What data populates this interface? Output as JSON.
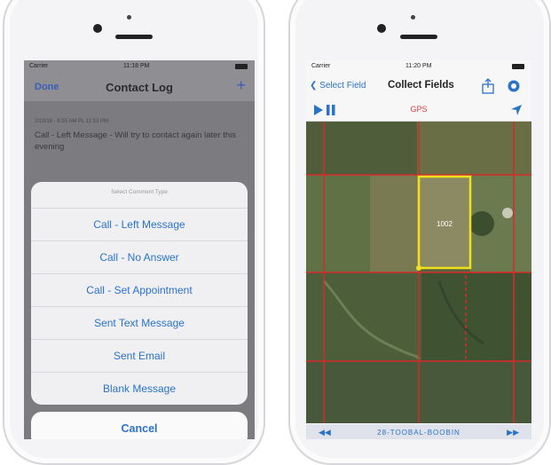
{
  "left_screen": {
    "status": {
      "carrier": "Carrier",
      "time": "11:18 PM"
    },
    "nav": {
      "done_label": "Done",
      "title": "Contact Log",
      "add_icon": "+"
    },
    "log": {
      "meta": "2/19/18 - 8:55 AM PL 11:53 PM",
      "text": "Call - Left Message - Will try to contact again later this evening"
    },
    "action_sheet": {
      "title": "Select Comment Type",
      "actions": [
        "Call - Left Message",
        "Call - No Answer",
        "Call - Set Appointment",
        "Sent Text Message",
        "Sent Email",
        "Blank Message"
      ],
      "cancel_label": "Cancel"
    }
  },
  "right_screen": {
    "status": {
      "carrier": "Carrier",
      "time": "11:20 PM"
    },
    "nav": {
      "back_label": "Select Field",
      "title": "Collect Fields"
    },
    "toolbar": {
      "gps_label": "GPS"
    },
    "map": {
      "field_label": "1002"
    },
    "bottom": {
      "label": "28-TOOBAL-BOOBIN"
    }
  },
  "colors": {
    "accent": "#2a73c9",
    "gps": "#e23b3b",
    "field_highlight": "#f2e01c",
    "boundary": "#d62a2a"
  }
}
